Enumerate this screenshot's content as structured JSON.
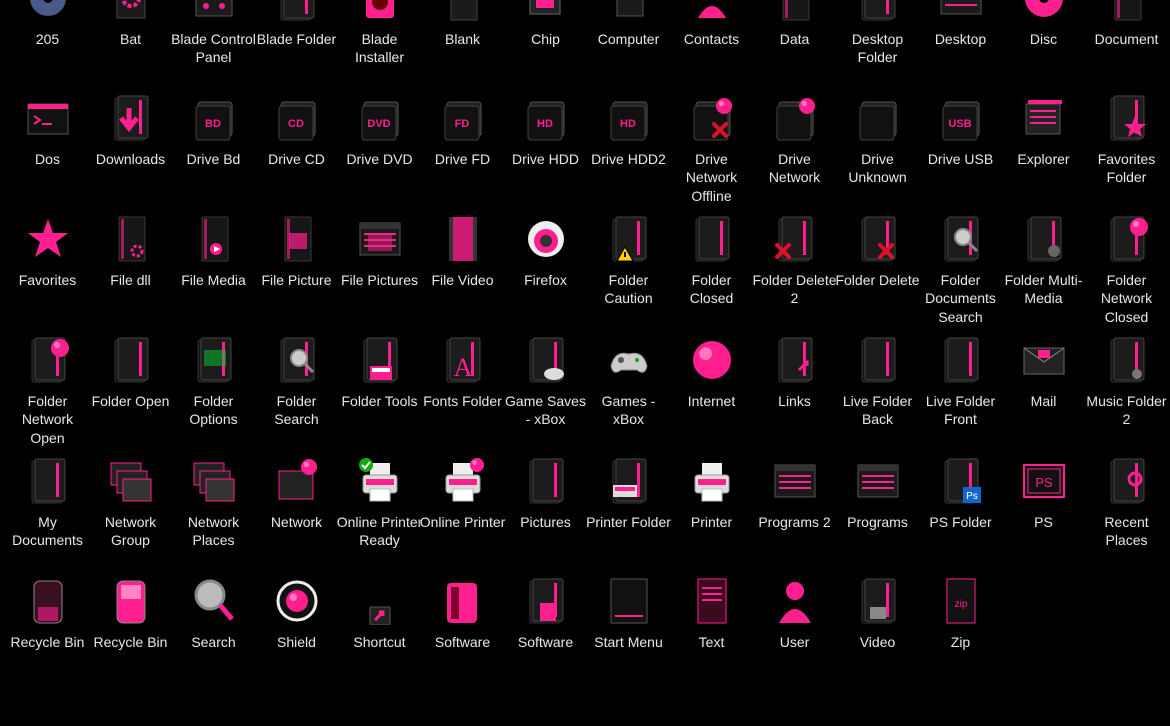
{
  "accent": "#ff1f8f",
  "rows": [
    [
      {
        "label": "205",
        "icon": "disc-blue-icon"
      },
      {
        "label": "Bat",
        "icon": "gear-file-icon"
      },
      {
        "label": "Blade Control Panel",
        "icon": "control-panel-icon"
      },
      {
        "label": "Blade Folder",
        "icon": "folder-icon"
      },
      {
        "label": "Blade Installer",
        "icon": "installer-icon"
      },
      {
        "label": "Blank",
        "icon": "blank-file-icon"
      },
      {
        "label": "Chip",
        "icon": "chip-icon"
      },
      {
        "label": "Computer",
        "icon": "computer-icon"
      },
      {
        "label": "Contacts",
        "icon": "contacts-icon"
      },
      {
        "label": "Data",
        "icon": "data-file-icon"
      },
      {
        "label": "Desktop Folder",
        "icon": "desktop-folder-icon"
      },
      {
        "label": "Desktop",
        "icon": "desktop-icon"
      },
      {
        "label": "Disc",
        "icon": "disc-icon"
      },
      {
        "label": "Document",
        "icon": "document-icon"
      }
    ],
    [
      {
        "label": "Dos",
        "icon": "terminal-icon"
      },
      {
        "label": "Downloads",
        "icon": "downloads-folder-icon"
      },
      {
        "label": "Drive Bd",
        "icon": "drive-bd-icon",
        "tag": "BD"
      },
      {
        "label": "Drive CD",
        "icon": "drive-cd-icon",
        "tag": "CD"
      },
      {
        "label": "Drive DVD",
        "icon": "drive-dvd-icon",
        "tag": "DVD"
      },
      {
        "label": "Drive FD",
        "icon": "drive-fd-icon",
        "tag": "FD"
      },
      {
        "label": "Drive HDD",
        "icon": "drive-hdd-icon",
        "tag": "HD"
      },
      {
        "label": "Drive HDD2",
        "icon": "drive-hdd2-icon",
        "tag": "HD"
      },
      {
        "label": "Drive Network Offline",
        "icon": "drive-network-offline-icon"
      },
      {
        "label": "Drive Network",
        "icon": "drive-network-icon"
      },
      {
        "label": "Drive Unknown",
        "icon": "drive-unknown-icon"
      },
      {
        "label": "Drive USB",
        "icon": "drive-usb-icon",
        "tag": "USB"
      },
      {
        "label": "Explorer",
        "icon": "explorer-icon"
      },
      {
        "label": "Favorites Folder",
        "icon": "favorites-folder-icon"
      }
    ],
    [
      {
        "label": "Favorites",
        "icon": "star-icon"
      },
      {
        "label": "File dll",
        "icon": "dll-file-icon"
      },
      {
        "label": "File Media",
        "icon": "media-file-icon"
      },
      {
        "label": "File Picture",
        "icon": "picture-file-icon"
      },
      {
        "label": "File Pictures",
        "icon": "pictures-window-icon"
      },
      {
        "label": "File Video",
        "icon": "video-file-icon"
      },
      {
        "label": "Firefox",
        "icon": "firefox-icon"
      },
      {
        "label": "Folder Caution",
        "icon": "folder-caution-icon"
      },
      {
        "label": "Folder Closed",
        "icon": "folder-closed-icon"
      },
      {
        "label": "Folder Delete 2",
        "icon": "folder-delete2-icon"
      },
      {
        "label": "Folder Delete",
        "icon": "folder-delete-icon"
      },
      {
        "label": "Folder Documents Search",
        "icon": "folder-search-docs-icon"
      },
      {
        "label": "Folder Multi-Media",
        "icon": "folder-multimedia-icon"
      },
      {
        "label": "Folder Network Closed",
        "icon": "folder-network-closed-icon"
      }
    ],
    [
      {
        "label": "Folder Network Open",
        "icon": "folder-network-open-icon"
      },
      {
        "label": "Folder Open",
        "icon": "folder-open-icon"
      },
      {
        "label": "Folder Options",
        "icon": "folder-options-icon"
      },
      {
        "label": "Folder Search",
        "icon": "folder-search-icon"
      },
      {
        "label": "Folder Tools",
        "icon": "folder-tools-icon"
      },
      {
        "label": "Fonts Folder",
        "icon": "fonts-folder-icon"
      },
      {
        "label": "Game Saves - xBox",
        "icon": "game-saves-icon"
      },
      {
        "label": "Games - xBox",
        "icon": "gamepad-icon"
      },
      {
        "label": "Internet",
        "icon": "globe-icon"
      },
      {
        "label": "Links",
        "icon": "links-folder-icon"
      },
      {
        "label": "Live Folder Back",
        "icon": "live-folder-back-icon"
      },
      {
        "label": "Live Folder Front",
        "icon": "live-folder-front-icon"
      },
      {
        "label": "Mail",
        "icon": "mail-icon"
      },
      {
        "label": "Music Folder 2",
        "icon": "music-folder-icon"
      }
    ],
    [
      {
        "label": "My Documents",
        "icon": "my-documents-icon"
      },
      {
        "label": "Network Group",
        "icon": "network-group-icon"
      },
      {
        "label": "Network Places",
        "icon": "network-places-icon"
      },
      {
        "label": "Network",
        "icon": "network-icon"
      },
      {
        "label": "Online Printer Ready",
        "icon": "printer-ready-icon"
      },
      {
        "label": "Online Printer",
        "icon": "online-printer-icon"
      },
      {
        "label": "Pictures",
        "icon": "pictures-folder-icon"
      },
      {
        "label": "Printer Folder",
        "icon": "printer-folder-icon"
      },
      {
        "label": "Printer",
        "icon": "printer-icon"
      },
      {
        "label": "Programs 2",
        "icon": "programs2-icon"
      },
      {
        "label": "Programs",
        "icon": "programs-icon"
      },
      {
        "label": "PS Folder",
        "icon": "ps-folder-icon"
      },
      {
        "label": "PS",
        "icon": "ps-icon",
        "tag": "PS"
      },
      {
        "label": "Recent Places",
        "icon": "recent-places-icon"
      }
    ],
    [
      {
        "label": "Recycle Bin",
        "icon": "recycle-bin-empty-icon"
      },
      {
        "label": "Recycle Bin",
        "icon": "recycle-bin-full-icon"
      },
      {
        "label": "Search",
        "icon": "magnifier-icon"
      },
      {
        "label": "Shield",
        "icon": "shield-icon"
      },
      {
        "label": "Shortcut",
        "icon": "shortcut-icon"
      },
      {
        "label": "Software",
        "icon": "software-box-icon"
      },
      {
        "label": "Software",
        "icon": "software-folder-icon"
      },
      {
        "label": "Start Menu",
        "icon": "start-menu-icon"
      },
      {
        "label": "Text",
        "icon": "text-file-icon"
      },
      {
        "label": "User",
        "icon": "user-icon"
      },
      {
        "label": "Video",
        "icon": "video-folder-icon"
      },
      {
        "label": "Zip",
        "icon": "zip-icon",
        "tag": "zip"
      }
    ]
  ]
}
